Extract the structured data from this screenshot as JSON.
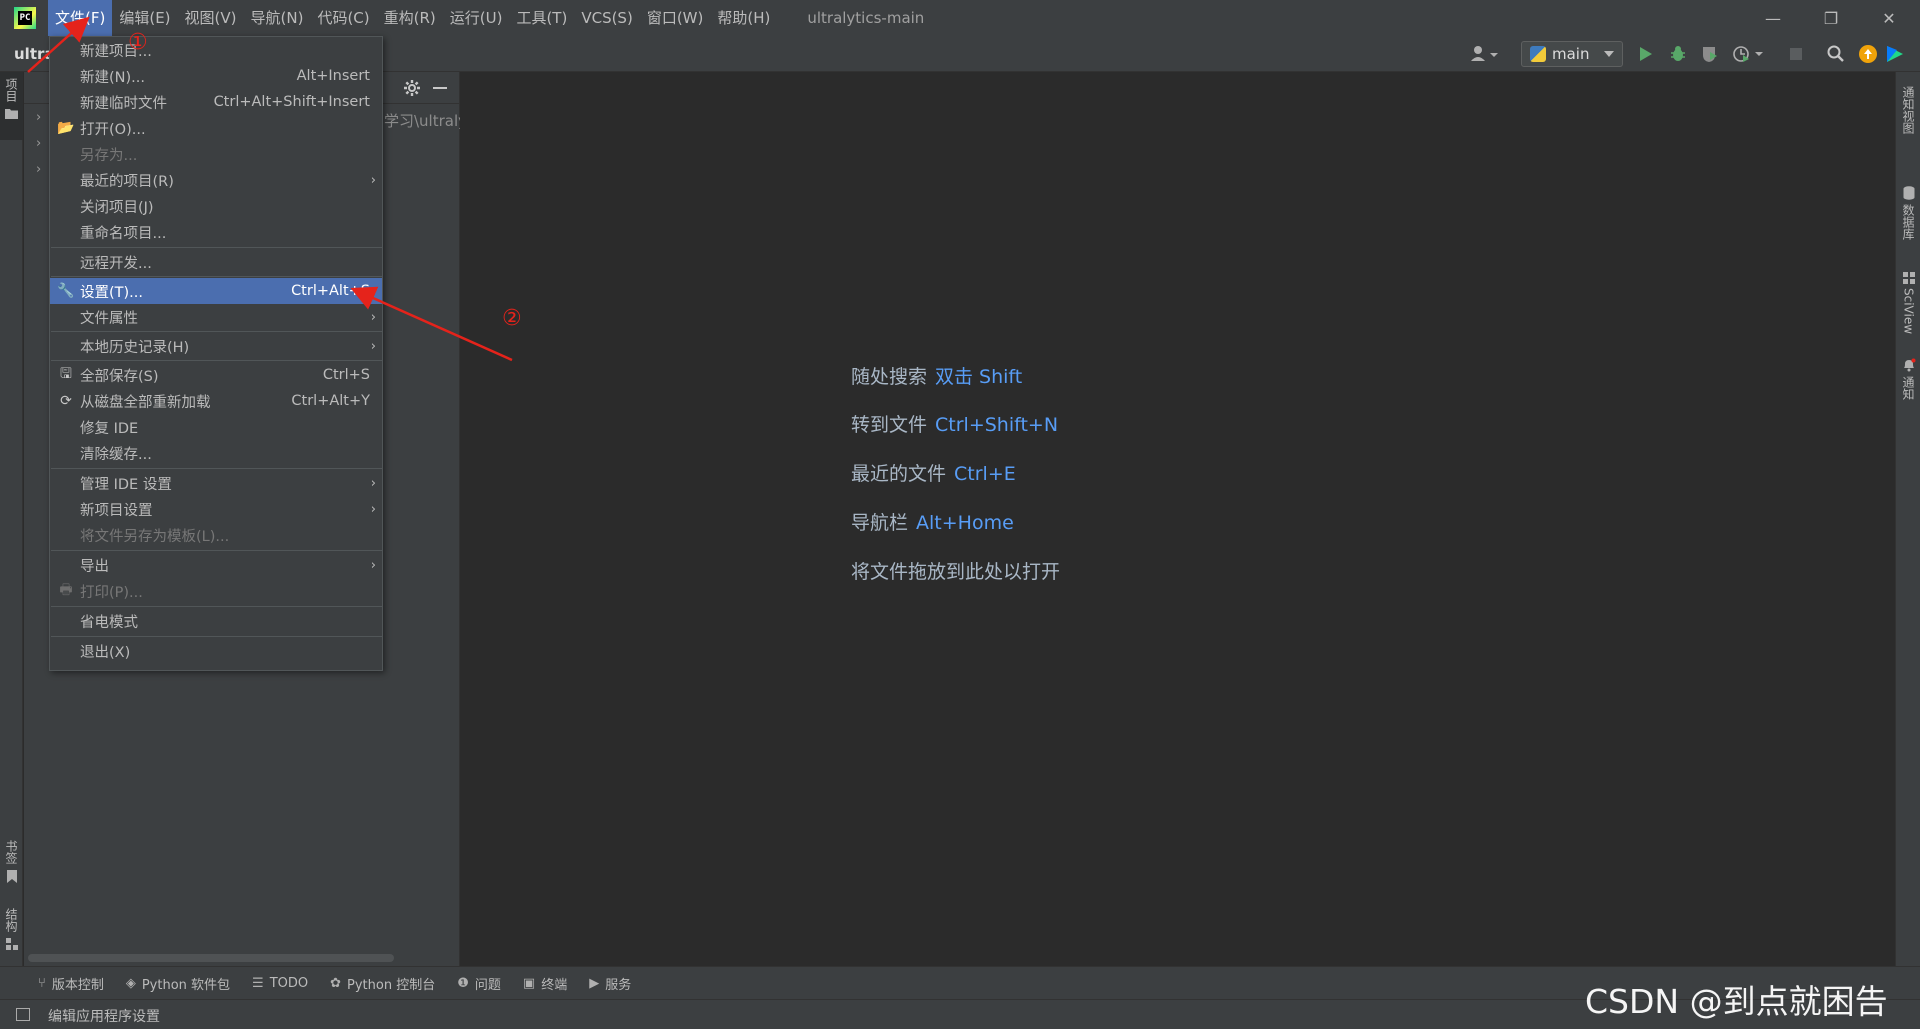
{
  "titlebar": {
    "menus": [
      "文件(F)",
      "编辑(E)",
      "视图(V)",
      "导航(N)",
      "代码(C)",
      "重构(R)",
      "运行(U)",
      "工具(T)",
      "VCS(S)",
      "窗口(W)",
      "帮助(H)"
    ],
    "window_title": "ultralytics-main",
    "minimize": "—",
    "restore": "❐",
    "close": "✕"
  },
  "navbar": {
    "project_crumb": "ultra",
    "run_config": "main"
  },
  "left_stripe": {
    "project_tab": "项目",
    "bookmarks_tab": "书签",
    "structure_tab": "结构"
  },
  "right_stripe": {
    "tabs": [
      "通知视图",
      "数据库",
      "SciView",
      "通知"
    ]
  },
  "project_panel": {
    "path_fragment": "学习\\ultraly"
  },
  "file_menu": {
    "items": [
      {
        "label": "新建项目...",
        "shortcut": ""
      },
      {
        "label": "新建(N)...",
        "shortcut": "Alt+Insert"
      },
      {
        "label": "新建临时文件",
        "shortcut": "Ctrl+Alt+Shift+Insert"
      },
      {
        "label": "打开(O)...",
        "shortcut": ""
      },
      {
        "label": "另存为...",
        "shortcut": ""
      },
      {
        "label": "最近的项目(R)",
        "shortcut": ""
      },
      {
        "label": "关闭项目(J)",
        "shortcut": ""
      },
      {
        "label": "重命名项目...",
        "shortcut": ""
      },
      {
        "label": "远程开发...",
        "shortcut": ""
      },
      {
        "label": "设置(T)...",
        "shortcut": "Ctrl+Alt+S"
      },
      {
        "label": "文件属性",
        "shortcut": ""
      },
      {
        "label": "本地历史记录(H)",
        "shortcut": ""
      },
      {
        "label": "全部保存(S)",
        "shortcut": "Ctrl+S"
      },
      {
        "label": "从磁盘全部重新加载",
        "shortcut": "Ctrl+Alt+Y"
      },
      {
        "label": "修复 IDE",
        "shortcut": ""
      },
      {
        "label": "清除缓存...",
        "shortcut": ""
      },
      {
        "label": "管理 IDE 设置",
        "shortcut": ""
      },
      {
        "label": "新项目设置",
        "shortcut": ""
      },
      {
        "label": "将文件另存为模板(L)...",
        "shortcut": ""
      },
      {
        "label": "导出",
        "shortcut": ""
      },
      {
        "label": "打印(P)...",
        "shortcut": ""
      },
      {
        "label": "省电模式",
        "shortcut": ""
      },
      {
        "label": "退出(X)",
        "shortcut": ""
      }
    ]
  },
  "editor_hints": [
    {
      "label": "随处搜索",
      "key": "双击 Shift"
    },
    {
      "label": "转到文件",
      "key": "Ctrl+Shift+N"
    },
    {
      "label": "最近的文件",
      "key": "Ctrl+E"
    },
    {
      "label": "导航栏",
      "key": "Alt+Home"
    },
    {
      "label": "将文件拖放到此处以打开",
      "key": ""
    }
  ],
  "toolwindow_bar": {
    "items": [
      "版本控制",
      "Python 软件包",
      "TODO",
      "Python 控制台",
      "问题",
      "终端",
      "服务"
    ]
  },
  "statusbar": {
    "text": "编辑应用程序设置"
  },
  "annotations": {
    "step1": "①",
    "step2": "②",
    "color": "#e5231b"
  },
  "watermark": "CSDN @到点就困告"
}
